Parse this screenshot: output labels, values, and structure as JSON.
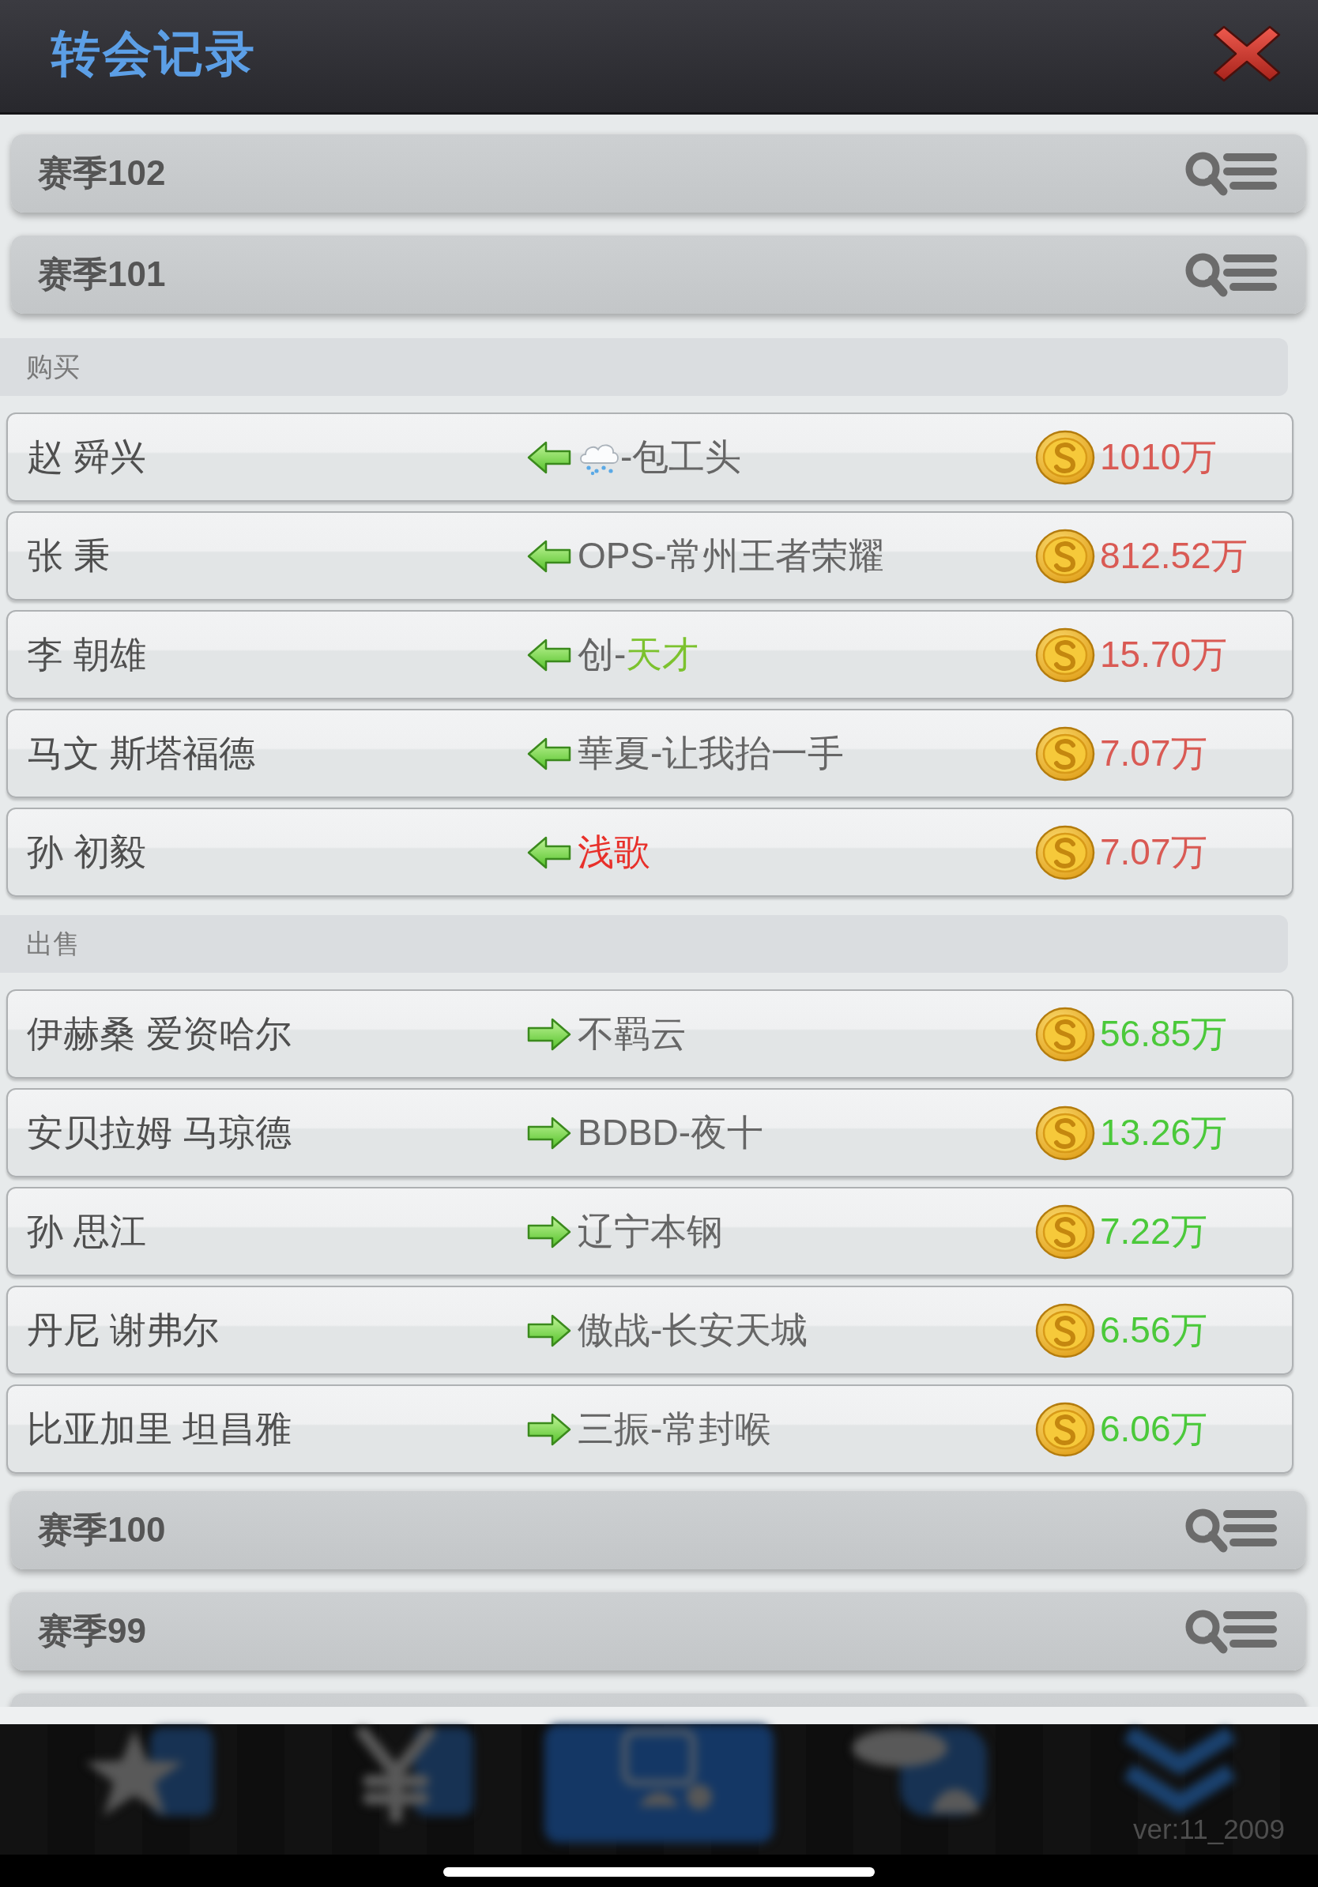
{
  "header": {
    "title": "转会记录"
  },
  "seasons": [
    {
      "title": "赛季102"
    },
    {
      "title": "赛季101",
      "sections": [
        {
          "kind": "buy",
          "label": "购买",
          "rows": [
            {
              "player": "赵 舜兴",
              "team": [
                {
                  "kind": "emoji"
                },
                {
                  "kind": "text",
                  "text": "-包工头"
                }
              ],
              "price": "1010万"
            },
            {
              "player": "张 秉",
              "team": [
                {
                  "kind": "text",
                  "text": "OPS-常州王者荣耀"
                }
              ],
              "price": "812.52万"
            },
            {
              "player": "李 朝雄",
              "team": [
                {
                  "kind": "text",
                  "text": "创-"
                },
                {
                  "kind": "text",
                  "text": "天才",
                  "color": "#7cc22e"
                }
              ],
              "price": "15.70万"
            },
            {
              "player": "马文 斯塔福德",
              "team": [
                {
                  "kind": "text",
                  "text": "華夏-让我抬一手"
                }
              ],
              "price": "7.07万"
            },
            {
              "player": "孙 初毅",
              "team": [
                {
                  "kind": "text",
                  "text": "浅歌",
                  "color": "#e8302a"
                }
              ],
              "price": "7.07万"
            }
          ]
        },
        {
          "kind": "sell",
          "label": "出售",
          "rows": [
            {
              "player": "伊赫桑 爱资哈尔",
              "team": [
                {
                  "kind": "text",
                  "text": "不羁云"
                }
              ],
              "price": "56.85万"
            },
            {
              "player": "安贝拉姆 马琼德",
              "team": [
                {
                  "kind": "text",
                  "text": "BDBD-夜十"
                }
              ],
              "price": "13.26万"
            },
            {
              "player": "孙 思江",
              "team": [
                {
                  "kind": "text",
                  "text": "辽宁本钢"
                }
              ],
              "price": "7.22万"
            },
            {
              "player": "丹尼 谢弗尔",
              "team": [
                {
                  "kind": "text",
                  "text": "傲战-长安天城"
                }
              ],
              "price": "6.56万"
            },
            {
              "player": "比亚加里 坦昌雅",
              "team": [
                {
                  "kind": "text",
                  "text": "三振-常封喉"
                }
              ],
              "price": "6.06万"
            }
          ]
        }
      ]
    },
    {
      "title": "赛季100"
    },
    {
      "title": "赛季99"
    }
  ],
  "bottom_bar": {
    "tabs": [
      {
        "kind": "star",
        "selected": false
      },
      {
        "kind": "yen",
        "selected": false
      },
      {
        "kind": "tile",
        "selected": true
      },
      {
        "kind": "bubble",
        "selected": false
      },
      {
        "kind": "chevrons",
        "selected": false
      }
    ],
    "version": "ver:11_2009"
  }
}
